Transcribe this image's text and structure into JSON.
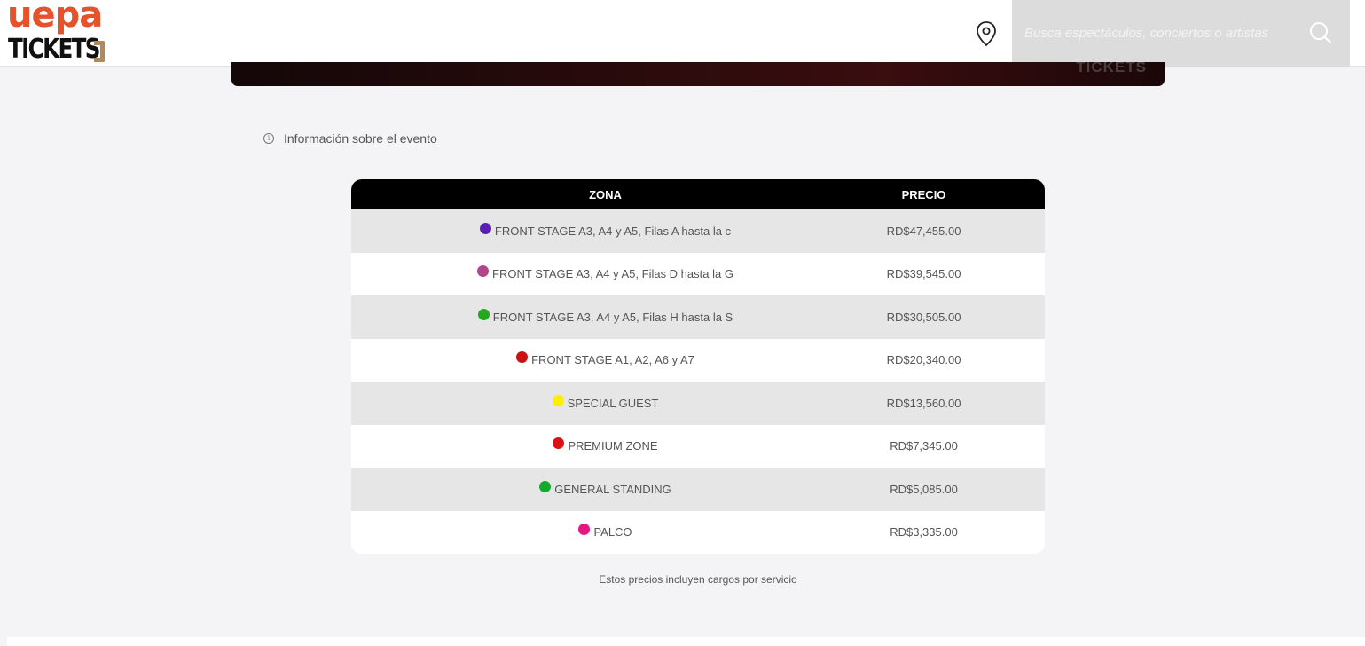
{
  "header": {
    "logo_top": "uepa",
    "logo_bottom": "TICKETS",
    "search_placeholder": "Busca espectáculos, conciertos o artistas"
  },
  "banner": {
    "brand": "TICKETS"
  },
  "event_info_label": "Información sobre el evento",
  "table": {
    "zone_header": "ZONA",
    "price_header": "PRECIO",
    "rows": [
      {
        "zone": "FRONT STAGE A3, A4 y A5, Filas A hasta la c",
        "price": "RD$47,455.00",
        "color": "#5a1fb8"
      },
      {
        "zone": "FRONT STAGE A3, A4 y A5, Filas D hasta la G",
        "price": "RD$39,545.00",
        "color": "#b0478c"
      },
      {
        "zone": "FRONT STAGE A3, A4 y A5, Filas H hasta la S",
        "price": "RD$30,505.00",
        "color": "#24a81e"
      },
      {
        "zone": "FRONT STAGE A1, A2, A6 y A7",
        "price": "RD$20,340.00",
        "color": "#cc1111"
      },
      {
        "zone": "SPECIAL GUEST",
        "price": "RD$13,560.00",
        "color": "#ffee00"
      },
      {
        "zone": "PREMIUM ZONE",
        "price": "RD$7,345.00",
        "color": "#dd1111"
      },
      {
        "zone": "GENERAL STANDING",
        "price": "RD$5,085.00",
        "color": "#14aa2e"
      },
      {
        "zone": "PALCO",
        "price": "RD$3,335.00",
        "color": "#e5177f"
      }
    ]
  },
  "footnote": "Estos precios incluyen cargos por servicio"
}
